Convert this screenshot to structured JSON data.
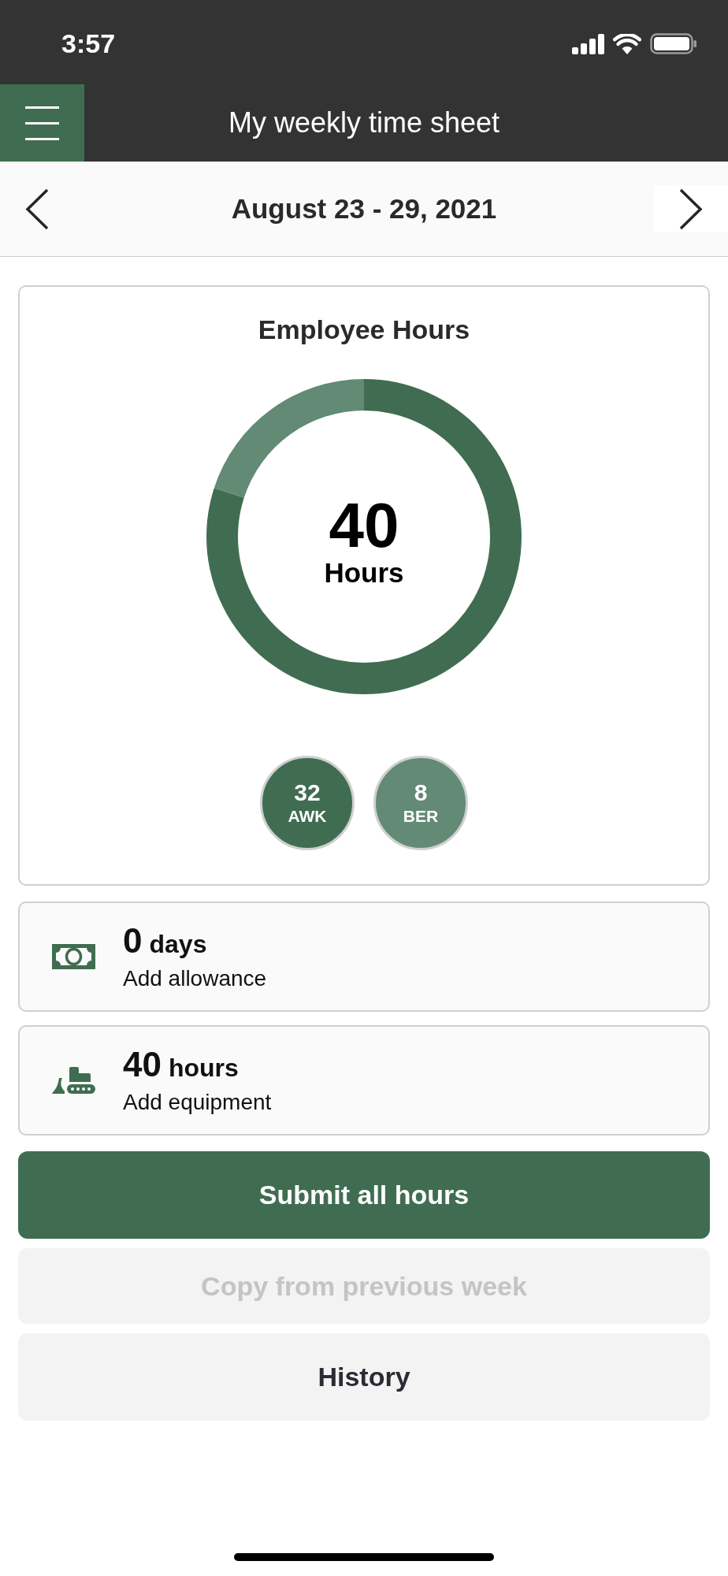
{
  "status_bar": {
    "time": "3:57"
  },
  "header": {
    "title": "My weekly time sheet"
  },
  "week_nav": {
    "date_range": "August 23 - 29, 2021"
  },
  "employee_hours": {
    "title": "Employee Hours",
    "total": {
      "value": "40",
      "label": "Hours"
    },
    "chart_data": {
      "type": "donut",
      "categories": [
        "AWK",
        "BER"
      ],
      "values": [
        80,
        20
      ]
    },
    "legend": [
      {
        "value": "32",
        "color": "#406d51"
      },
      {
        "value": "8",
        "color": "#638a74"
      }
    ]
  },
  "summary_items": [
    {
      "kind": "allowance",
      "amount": "0",
      "unit": "days",
      "action": "Add allowance"
    },
    {
      "kind": "equipment",
      "amount": "40",
      "unit": "hours",
      "action": "Add equipment"
    }
  ],
  "buttons": [
    {
      "label": "Submit all hours",
      "kind": "primary",
      "disabled": false
    },
    {
      "label": "Copy from previous week",
      "kind": "secondary",
      "disabled": true
    },
    {
      "label": "History",
      "kind": "secondary",
      "disabled": false
    }
  ]
}
